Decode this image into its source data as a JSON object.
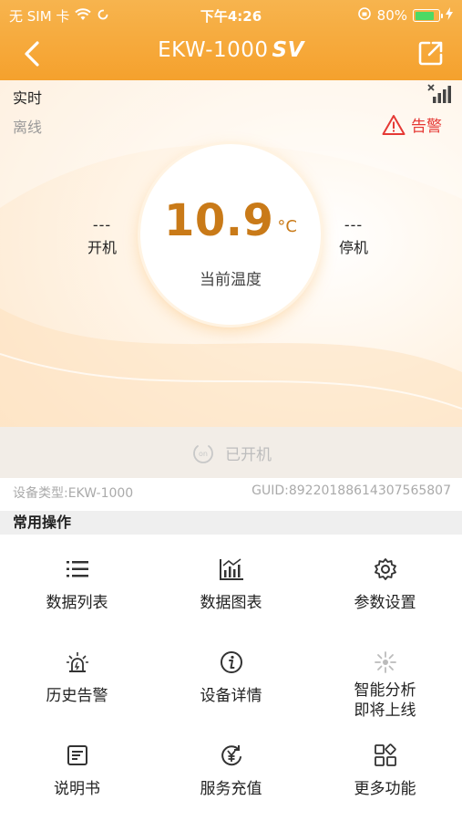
{
  "status_bar": {
    "carrier": "无 SIM 卡",
    "time": "下午4:26",
    "battery_percent": "80%",
    "battery_level": 0.8
  },
  "nav": {
    "title": "EKW-1000",
    "title_badge": "SV"
  },
  "realtime": {
    "section_label": "实时",
    "status_text": "离线",
    "alarm_label": "告警",
    "temperature": "10.9",
    "temperature_unit": "°C",
    "temperature_caption": "当前温度",
    "left_value": "---",
    "left_label": "开机",
    "right_value": "---",
    "right_label": "停机",
    "power_label": "已开机",
    "power_icon_text": "on"
  },
  "device": {
    "type_text": "设备类型:EKW-1000",
    "guid_text": "GUID:89220188614307565807"
  },
  "common_ops": {
    "title": "常用操作",
    "items": [
      {
        "label": "数据列表",
        "icon": "list-icon"
      },
      {
        "label": "数据图表",
        "icon": "chart-icon"
      },
      {
        "label": "参数设置",
        "icon": "gear-icon"
      },
      {
        "label": "历史告警",
        "icon": "alarm-light-icon"
      },
      {
        "label": "设备详情",
        "icon": "info-icon"
      },
      {
        "label": "智能分析",
        "label2": "即将上线",
        "icon": "sparkle-icon"
      },
      {
        "label": "说明书",
        "icon": "manual-icon"
      },
      {
        "label": "服务充值",
        "icon": "recharge-icon"
      },
      {
        "label": "更多功能",
        "icon": "more-apps-icon"
      }
    ]
  },
  "colors": {
    "accent": "#f5a12d",
    "temperature": "#c97a18",
    "alarm": "#e53935"
  }
}
